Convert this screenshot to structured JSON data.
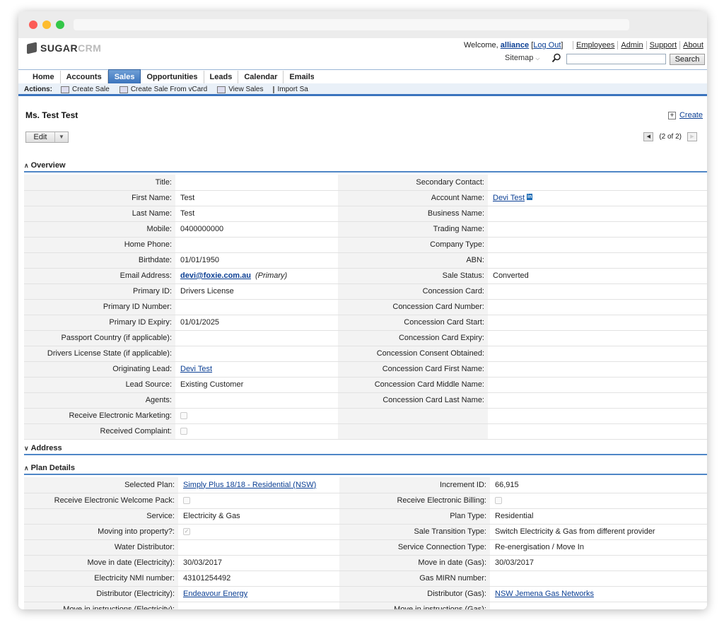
{
  "header": {
    "logo": {
      "text_a": "SUGAR",
      "text_b": "CRM"
    },
    "welcome": {
      "prefix": "Welcome,",
      "user": "alliance",
      "open_bracket": "[",
      "logout": "Log Out",
      "close_bracket": "]"
    },
    "toplinks": [
      "Employees",
      "Admin",
      "Support",
      "About"
    ],
    "sitemap": "Sitemap",
    "search_button": "Search",
    "search_placeholder": ""
  },
  "nav": {
    "tabs": [
      {
        "label": "Home"
      },
      {
        "label": "Accounts"
      },
      {
        "label": "Sales",
        "active": true
      },
      {
        "label": "Opportunities"
      },
      {
        "label": "Leads"
      },
      {
        "label": "Calendar"
      },
      {
        "label": "Emails"
      }
    ],
    "actions_label": "Actions:",
    "actions": [
      "Create Sale",
      "Create Sale From vCard",
      "View Sales",
      "Import Sales"
    ]
  },
  "record": {
    "title": "Ms. Test Test",
    "create_label": "Create",
    "edit_label": "Edit",
    "pager": "(2 of 2)"
  },
  "sections": {
    "overview": "Overview",
    "address": "Address",
    "plan": "Plan Details"
  },
  "overview": {
    "rows": [
      {
        "l1": "Title:",
        "v1": "",
        "l2": "Secondary Contact:",
        "v2": ""
      },
      {
        "l1": "First Name:",
        "v1": "Test",
        "l2": "Account Name:",
        "v2": "Devi Test"
      },
      {
        "l1": "Last Name:",
        "v1": "Test",
        "l2": "Business Name:",
        "v2": ""
      },
      {
        "l1": "Mobile:",
        "v1": "0400000000",
        "l2": "Trading Name:",
        "v2": ""
      },
      {
        "l1": "Home Phone:",
        "v1": "",
        "l2": "Company Type:",
        "v2": ""
      },
      {
        "l1": "Birthdate:",
        "v1": "01/01/1950",
        "l2": "ABN:",
        "v2": ""
      },
      {
        "l1": "Email Address:",
        "v1": "devi@foxie.com.au",
        "v1b": "(Primary)",
        "l2": "Sale Status:",
        "v2": "Converted"
      },
      {
        "l1": "Primary ID:",
        "v1": "Drivers License",
        "l2": "Concession Card:",
        "v2": ""
      },
      {
        "l1": "Primary ID Number:",
        "v1": "",
        "l2": "Concession Card Number:",
        "v2": ""
      },
      {
        "l1": "Primary ID Expiry:",
        "v1": "01/01/2025",
        "l2": "Concession Card Start:",
        "v2": ""
      },
      {
        "l1": "Passport Country (if applicable):",
        "v1": "",
        "l2": "Concession Card Expiry:",
        "v2": ""
      },
      {
        "l1": "Drivers License State (if applicable):",
        "v1": "",
        "l2": "Concession Consent Obtained:",
        "v2": ""
      },
      {
        "l1": "Originating Lead:",
        "v1": "Devi Test",
        "l2": "Concession Card First Name:",
        "v2": ""
      },
      {
        "l1": "Lead Source:",
        "v1": "Existing Customer",
        "l2": "Concession Card Middle Name:",
        "v2": ""
      },
      {
        "l1": "Agents:",
        "v1": "",
        "l2": "Concession Card Last Name:",
        "v2": ""
      },
      {
        "l1": "Receive Electronic Marketing:",
        "v1": "",
        "l2": "",
        "v2": ""
      },
      {
        "l1": "Received Complaint:",
        "v1": "",
        "l2": "",
        "v2": ""
      }
    ],
    "linkedin_icon": "in"
  },
  "plan": {
    "rows": [
      {
        "l1": "Selected Plan:",
        "v1": "Simply Plus 18/18 - Residential (NSW)",
        "l2": "Increment ID:",
        "v2": "66,915"
      },
      {
        "l1": "Receive Electronic Welcome Pack:",
        "v1": "",
        "l2": "Receive Electronic Billing:",
        "v2": ""
      },
      {
        "l1": "Service:",
        "v1": "Electricity & Gas",
        "l2": "Plan Type:",
        "v2": "Residential"
      },
      {
        "l1": "Moving into property?:",
        "v1": "",
        "l2": "Sale Transition Type:",
        "v2": "Switch Electricity & Gas from different provider"
      },
      {
        "l1": "Water Distributor:",
        "v1": "",
        "l2": "Service Connection Type:",
        "v2": "Re-energisation / Move In"
      },
      {
        "l1": "Move in date (Electricity):",
        "v1": "30/03/2017",
        "l2": "Move in date (Gas):",
        "v2": "30/03/2017"
      },
      {
        "l1": "Electricity NMI number:",
        "v1": "43101254492",
        "l2": "Gas MIRN number:",
        "v2": ""
      },
      {
        "l1": "Distributor (Electricity):",
        "v1": "Endeavour Energy",
        "l2": "Distributor (Gas):",
        "v2": "NSW Jemena Gas Networks"
      },
      {
        "l1": "Move in instructions (Electricity):",
        "v1": "",
        "l2": "Move in instructions (Gas):",
        "v2": ""
      }
    ]
  },
  "colors": {
    "accent": "#3b74bd",
    "link": "#0b3f94",
    "label_bg": "#f3f3f3"
  },
  "icons": {
    "search": "magnifier-icon",
    "checkbox": "checkbox-icon",
    "create": "plus-icon"
  }
}
